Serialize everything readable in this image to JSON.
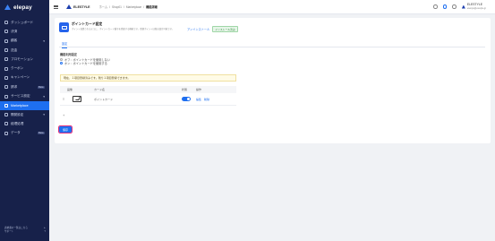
{
  "brand": {
    "name": "elepay"
  },
  "sidebar": {
    "items": [
      {
        "label": "ダッシュボード",
        "icon": "home-icon",
        "active": false
      },
      {
        "label": "決済",
        "icon": "payment-icon",
        "active": false
      },
      {
        "label": "顧客",
        "icon": "customer-icon",
        "active": false,
        "chevron": true
      },
      {
        "label": "送金",
        "icon": "transfer-icon",
        "active": false
      },
      {
        "label": "プロモーション",
        "icon": "promotion-icon",
        "active": false
      },
      {
        "label": "クーポン",
        "icon": "coupon-icon",
        "active": false
      },
      {
        "label": "キャンペーン",
        "icon": "campaign-icon",
        "active": false
      },
      {
        "label": "請求",
        "icon": "invoice-icon",
        "active": false,
        "tag": "Beta"
      },
      {
        "label": "サービス設定",
        "icon": "service-icon",
        "active": false,
        "chevron": true
      },
      {
        "label": "Marketplace",
        "icon": "marketplace-icon",
        "active": true
      },
      {
        "label": "開発設定",
        "icon": "developer-icon",
        "active": false,
        "chevron": true
      },
      {
        "label": "経理処理",
        "icon": "accounting-icon",
        "active": false
      },
      {
        "label": "データ",
        "icon": "data-icon",
        "active": false,
        "tag": "Beta"
      }
    ],
    "footer": {
      "line1": "請求書の一覧はこちら",
      "line2": "サポート"
    }
  },
  "header": {
    "store_name": "ELESTYLE",
    "breadcrumbs": [
      "ホーム",
      "Shop01",
      "Marketplace"
    ],
    "current": "機能詳細",
    "user": {
      "name": "ELESTYLE",
      "sub": "elestyle@elestyle.jp"
    }
  },
  "app": {
    "title": "ポイントカード設定",
    "description": "ポイント加算されるように、ポイントカード番号を登録する機能です。登録ポイントは独自設定可能です。",
    "uninstall_label": "アンインストール",
    "status_badge": "インストール済み"
  },
  "tabs": [
    {
      "label": "設定",
      "active": true
    }
  ],
  "settings": {
    "group_label": "機能利用設定",
    "options": [
      {
        "label": "オフ：ポイントカードを使用しない",
        "selected": false
      },
      {
        "label": "オン：ポイントカードを使用する",
        "selected": true
      }
    ]
  },
  "notice": "現在、１項目登録済みです。残り１項目登録できます。",
  "table": {
    "headers": {
      "image": "画像",
      "name": "カード名",
      "status": "状態",
      "actions": "操作"
    },
    "rows": [
      {
        "name": "ポイントカード",
        "enabled": true,
        "edit_label": "編集",
        "delete_label": "削除"
      }
    ]
  },
  "add_label": "+",
  "save_label": "保存"
}
